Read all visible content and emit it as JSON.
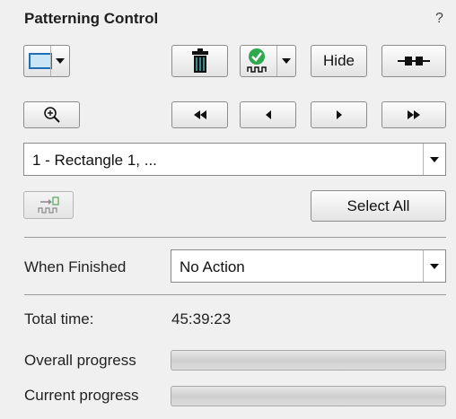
{
  "panel": {
    "title": "Patterning Control",
    "help": "?"
  },
  "toolbar": {
    "shape_selector_icon": "rectangle-icon",
    "delete_icon": "trash-icon",
    "status_icon": "checkmark-pattern-icon",
    "hide_label": "Hide",
    "link_icon": "link-icon"
  },
  "navigation": {
    "zoom_icon": "zoom-in-icon",
    "first_icon": "double-left-arrow-icon",
    "prev_icon": "left-arrow-icon",
    "next_icon": "right-arrow-icon",
    "last_icon": "double-right-arrow-icon"
  },
  "pattern_select": {
    "value": "1 - Rectangle 1, ..."
  },
  "actions": {
    "select_all_label": "Select All"
  },
  "when_finished": {
    "label": "When Finished",
    "value": "No Action"
  },
  "stats": {
    "total_time_label": "Total time:",
    "total_time_value": "45:39:23",
    "overall_progress_label": "Overall progress",
    "overall_progress_fraction": 0,
    "current_progress_label": "Current progress",
    "current_progress_fraction": 0
  },
  "colors": {
    "panel_bg": "#f0f0f0",
    "rect_fill": "#c9e6f7",
    "rect_border": "#1f6fb5",
    "check_green": "#2fa84f"
  }
}
